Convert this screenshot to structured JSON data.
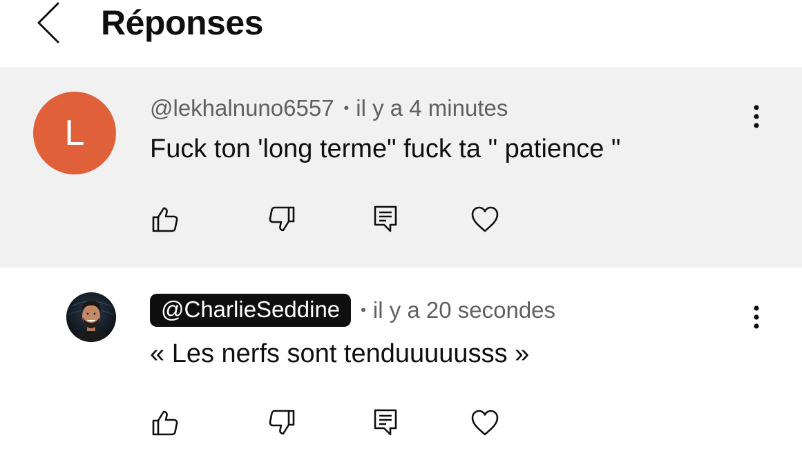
{
  "header": {
    "title": "Réponses",
    "back_icon": "chevron-left-icon"
  },
  "comments": [
    {
      "avatar_letter": "L",
      "avatar_color": "#e0603a",
      "author": "@lekhalnuno6557",
      "separator": "•",
      "time": "il y a 4 minutes",
      "text": "Fuck ton 'long terme\" fuck ta \" patience \"",
      "highlighted": true,
      "background": "#f1f1f1"
    },
    {
      "avatar_type": "photo",
      "author": "@CharlieSeddine",
      "author_badge": true,
      "separator": "•",
      "time": "il y a 20 secondes",
      "text": "« Les nerfs sont tenduuuuusss »",
      "highlighted": false,
      "background": "#ffffff"
    }
  ],
  "actions": {
    "icons": [
      "thumbs-up-icon",
      "thumbs-down-icon",
      "reply-icon",
      "heart-icon"
    ]
  },
  "colors": {
    "text_primary": "#0f0f0f",
    "text_secondary": "#606060",
    "highlight_bg": "#f1f1f1",
    "author_badge_bg": "#0f0f0f"
  }
}
